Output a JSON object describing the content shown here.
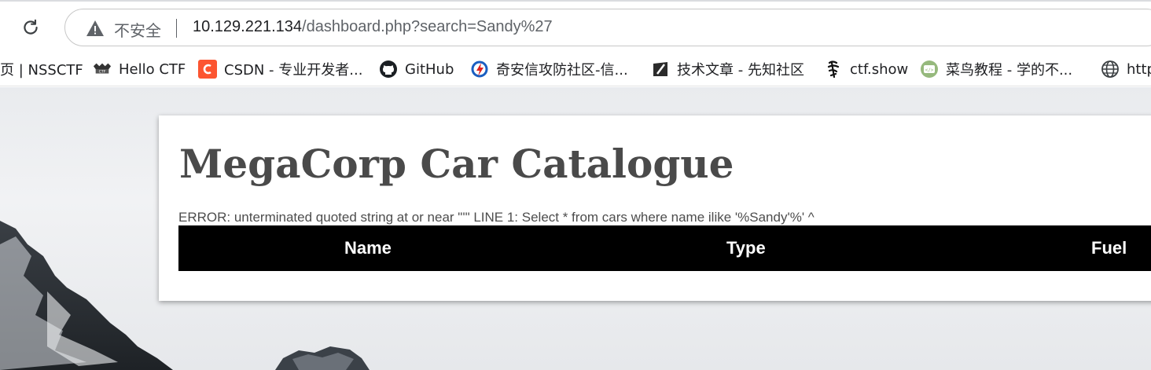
{
  "browser": {
    "security_label": "不安全",
    "url_host": "10.129.221.134",
    "url_path": "/dashboard.php?search=Sandy%27",
    "bookmarks": [
      {
        "label": "页 | NSSCTF",
        "icon": "nssctf-icon"
      },
      {
        "label": "Hello CTF",
        "icon": "hello-ctf-icon"
      },
      {
        "label": "CSDN - 专业开发者...",
        "icon": "csdn-icon"
      },
      {
        "label": "GitHub",
        "icon": "github-icon"
      },
      {
        "label": "奇安信攻防社区-信...",
        "icon": "qianxin-icon"
      },
      {
        "label": "技术文章 - 先知社区",
        "icon": "xianzhi-icon"
      },
      {
        "label": "ctf.show",
        "icon": "ctfshow-icon"
      },
      {
        "label": "菜鸟教程 - 学的不...",
        "icon": "runoob-icon"
      },
      {
        "label": "http",
        "icon": "globe-icon"
      }
    ]
  },
  "page": {
    "title": "MegaCorp Car Catalogue",
    "error": "ERROR: unterminated quoted string at or near \"'\" LINE 1: Select * from cars where name ilike '%Sandy'%' ^",
    "table": {
      "headers": [
        "Name",
        "Type",
        "Fuel"
      ]
    }
  },
  "colors": {
    "table_header_bg": "#000000",
    "title_color": "#4a4a4a"
  }
}
